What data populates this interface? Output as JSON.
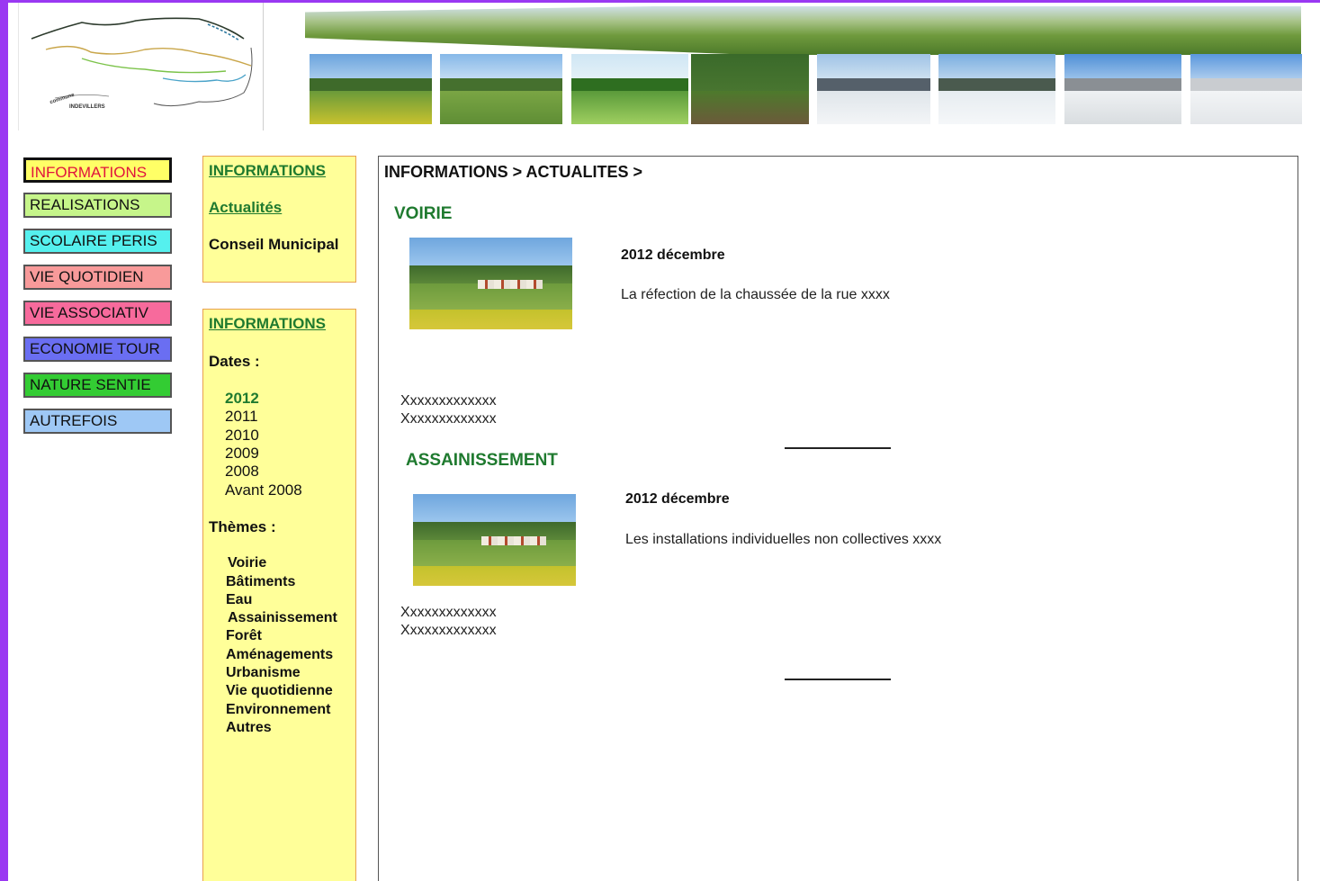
{
  "logo": {
    "line1": "commune",
    "line2": "INDEVILLERS"
  },
  "nav": [
    {
      "label": "INFORMATIONS",
      "color": "#ffff66",
      "active": true
    },
    {
      "label": "REALISATIONS",
      "color": "#c6f58a",
      "active": false
    },
    {
      "label": "SCOLAIRE PERIS",
      "color": "#55f0ee",
      "active": false
    },
    {
      "label": "VIE QUOTIDIEN",
      "color": "#f89a9a",
      "active": false
    },
    {
      "label": "VIE ASSOCIATIV",
      "color": "#f76a9c",
      "active": false
    },
    {
      "label": "ECONOMIE TOUR",
      "color": "#6a6ef2",
      "active": false
    },
    {
      "label": "NATURE SENTIE",
      "color": "#33cc33",
      "active": false
    },
    {
      "label": "AUTREFOIS",
      "color": "#9ec8f5",
      "active": false
    }
  ],
  "submenu": {
    "heading": "INFORMATIONS",
    "items": [
      "Actualités",
      "Conseil Municipal"
    ]
  },
  "filters": {
    "heading": "INFORMATIONS",
    "dates_label": "Dates :",
    "years": [
      "2012",
      "2011",
      "2010",
      "2009",
      "2008",
      "Avant 2008"
    ],
    "themes_label": "Thèmes :",
    "themes": [
      "Voirie",
      "Bâtiments",
      "Eau",
      "Assainissement",
      "Forêt",
      "Aménagements",
      "Urbanisme",
      "Vie quotidienne",
      "Environnement",
      "Autres"
    ]
  },
  "main": {
    "breadcrumb": "INFORMATIONS > ACTUALITES >",
    "articles": [
      {
        "section": "VOIRIE",
        "date": "2012 décembre",
        "text": "La réfection de la chaussée de la rue xxxx",
        "lines": [
          "Xxxxxxxxxxxxx",
          "Xxxxxxxxxxxxx"
        ]
      },
      {
        "section": "ASSAINISSEMENT",
        "date": "2012 décembre",
        "text": "Les installations individuelles non collectives xxxx",
        "lines": [
          "Xxxxxxxxxxxxx",
          "Xxxxxxxxxxxxx"
        ]
      }
    ]
  },
  "colors": {
    "page_frame": "#9a38f2",
    "accent_green": "#1f7a2f",
    "active_nav_text": "#e0133d",
    "panel_bg": "#ffff99"
  }
}
